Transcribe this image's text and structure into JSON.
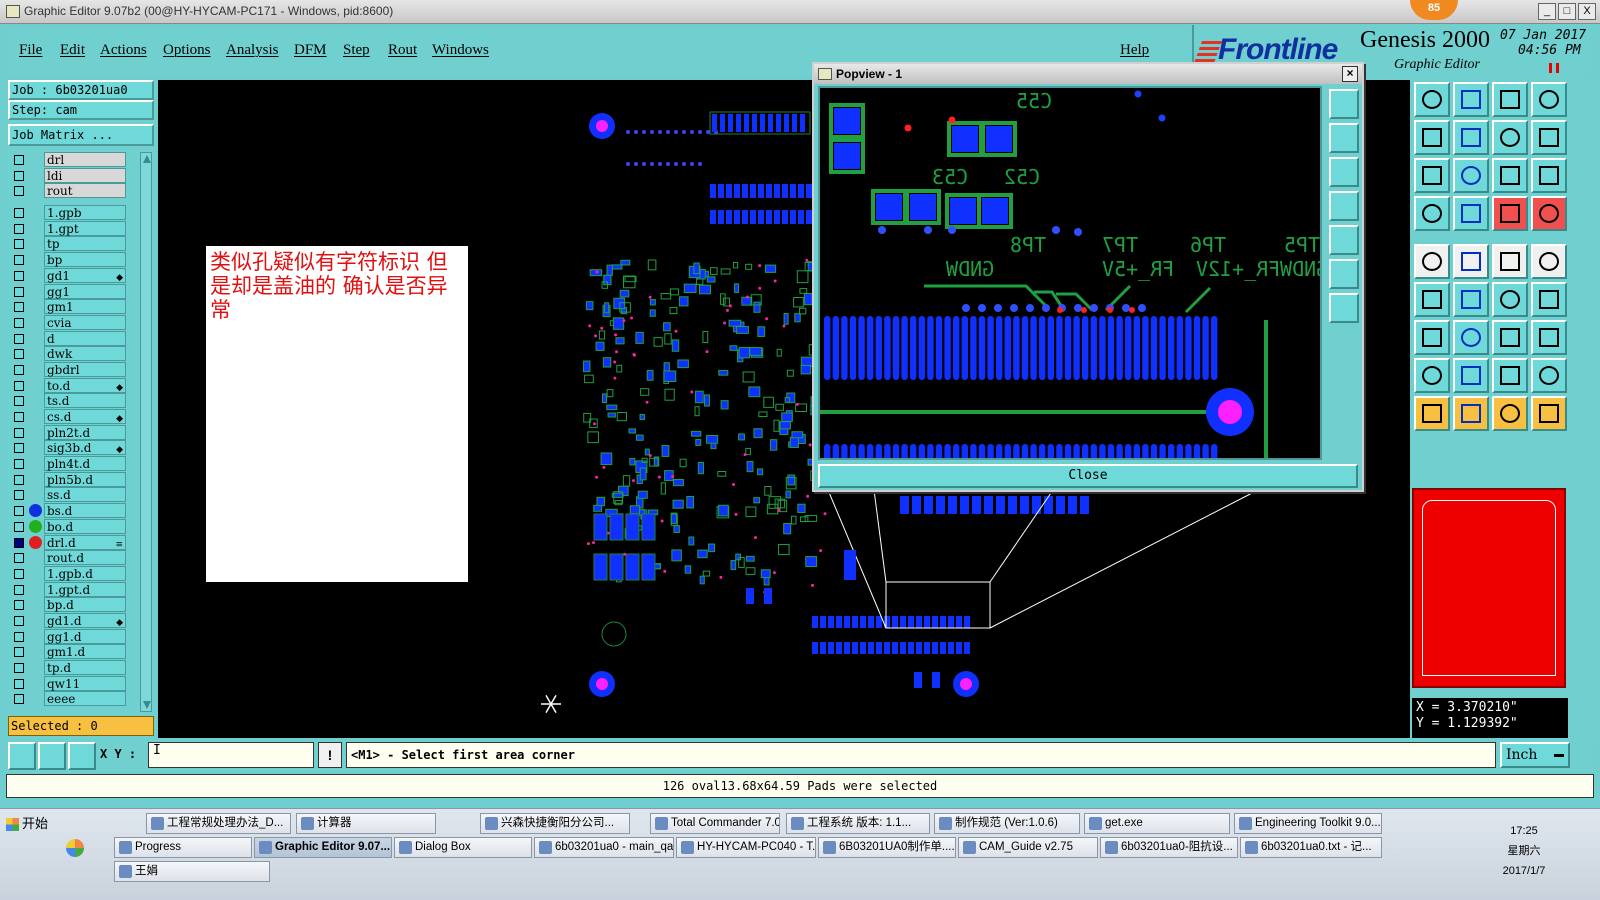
{
  "window": {
    "title": "Graphic Editor 9.07b2 (00@HY-HYCAM-PC171 - Windows, pid:8600)",
    "controls": [
      "_",
      "□",
      "X"
    ],
    "badge": "85"
  },
  "menu": [
    "File",
    "Edit",
    "Actions",
    "Options",
    "Analysis",
    "DFM",
    "Step",
    "Rout",
    "Windows"
  ],
  "help": "Help",
  "brand": {
    "logo": "Frontline",
    "product": "Genesis 2000",
    "subtitle": "Graphic Editor",
    "date": "07 Jan 2017",
    "time": "04:56 PM"
  },
  "left": {
    "job": "Job : 6b03201ua0",
    "step": "Step: cam",
    "job_matrix": "Job Matrix ...",
    "selected": "Selected : 0",
    "layers": [
      {
        "name": "drl",
        "hl": true
      },
      {
        "name": "ldi",
        "hl": true
      },
      {
        "name": "rout",
        "hl": true
      },
      {
        "name": "",
        "spacer": true
      },
      {
        "name": "1.gpb"
      },
      {
        "name": "1.gpt"
      },
      {
        "name": "tp"
      },
      {
        "name": "bp"
      },
      {
        "name": "gd1",
        "mark": "◆"
      },
      {
        "name": "gg1"
      },
      {
        "name": "gm1"
      },
      {
        "name": "cvia"
      },
      {
        "name": "d"
      },
      {
        "name": "dwk"
      },
      {
        "name": "gbdrl"
      },
      {
        "name": "to.d",
        "mark": "◆"
      },
      {
        "name": "ts.d"
      },
      {
        "name": "cs.d",
        "mark": "◆"
      },
      {
        "name": "pln2t.d"
      },
      {
        "name": "sig3b.d",
        "mark": "◆"
      },
      {
        "name": "pln4t.d"
      },
      {
        "name": "pln5b.d"
      },
      {
        "name": "ss.d"
      },
      {
        "name": "bs.d",
        "dot": "#1030e0"
      },
      {
        "name": "bo.d",
        "dot": "#20b020"
      },
      {
        "name": "drl.d",
        "dot": "#e02020",
        "mark": "≡",
        "dark": true
      },
      {
        "name": "rout.d"
      },
      {
        "name": "1.gpb.d"
      },
      {
        "name": "1.gpt.d"
      },
      {
        "name": "bp.d"
      },
      {
        "name": "gd1.d",
        "mark": "◆"
      },
      {
        "name": "gg1.d"
      },
      {
        "name": "gm1.d"
      },
      {
        "name": "tp.d"
      },
      {
        "name": "qw11"
      },
      {
        "name": "eeee"
      }
    ]
  },
  "note": "类似孔疑似有字符标识 但是却是盖油的 确认是否异常",
  "popview": {
    "title": "Popview - 1",
    "close": "Close",
    "labels": [
      "C55",
      "C53",
      "C52",
      "TP8",
      "TP7",
      "TP6",
      "TP5",
      "GNDW",
      "FR_+5V",
      "FR_+12V",
      "GNDW"
    ]
  },
  "coords": {
    "x": "X = 3.370210\"",
    "y": "Y = 1.129392\""
  },
  "cmd": {
    "xy_label": "X Y :",
    "xy_value": "I",
    "info": "!",
    "prompt": "<M1> - Select first area corner",
    "unit": "Inch"
  },
  "status": "126 oval13.68x64.59 Pads were selected",
  "taskbar": {
    "start": "开始",
    "row1": [
      "工程常规处理办法_D...",
      "计算器",
      "兴森快捷衡阳分公司...",
      "Total Commander 7.0 p...",
      "工程系统  版本: 1.1...",
      "制作规范 (Ver:1.0.6)",
      "get.exe",
      "Engineering Toolkit 9.0..."
    ],
    "row2": [
      "Progress",
      "Graphic Editor 9.07...",
      "Dialog Box",
      "6b03201ua0 - main_qa",
      "HY-HYCAM-PC040 - T...",
      "6B03201UA0制作单....",
      "CAM_Guide v2.75",
      "6b03201ua0-阻抗设...",
      "6b03201ua0.txt - 记..."
    ],
    "row3": [
      "王娟"
    ],
    "clock": {
      "time": "17:25",
      "day": "星期六",
      "date": "2017/1/7"
    }
  }
}
